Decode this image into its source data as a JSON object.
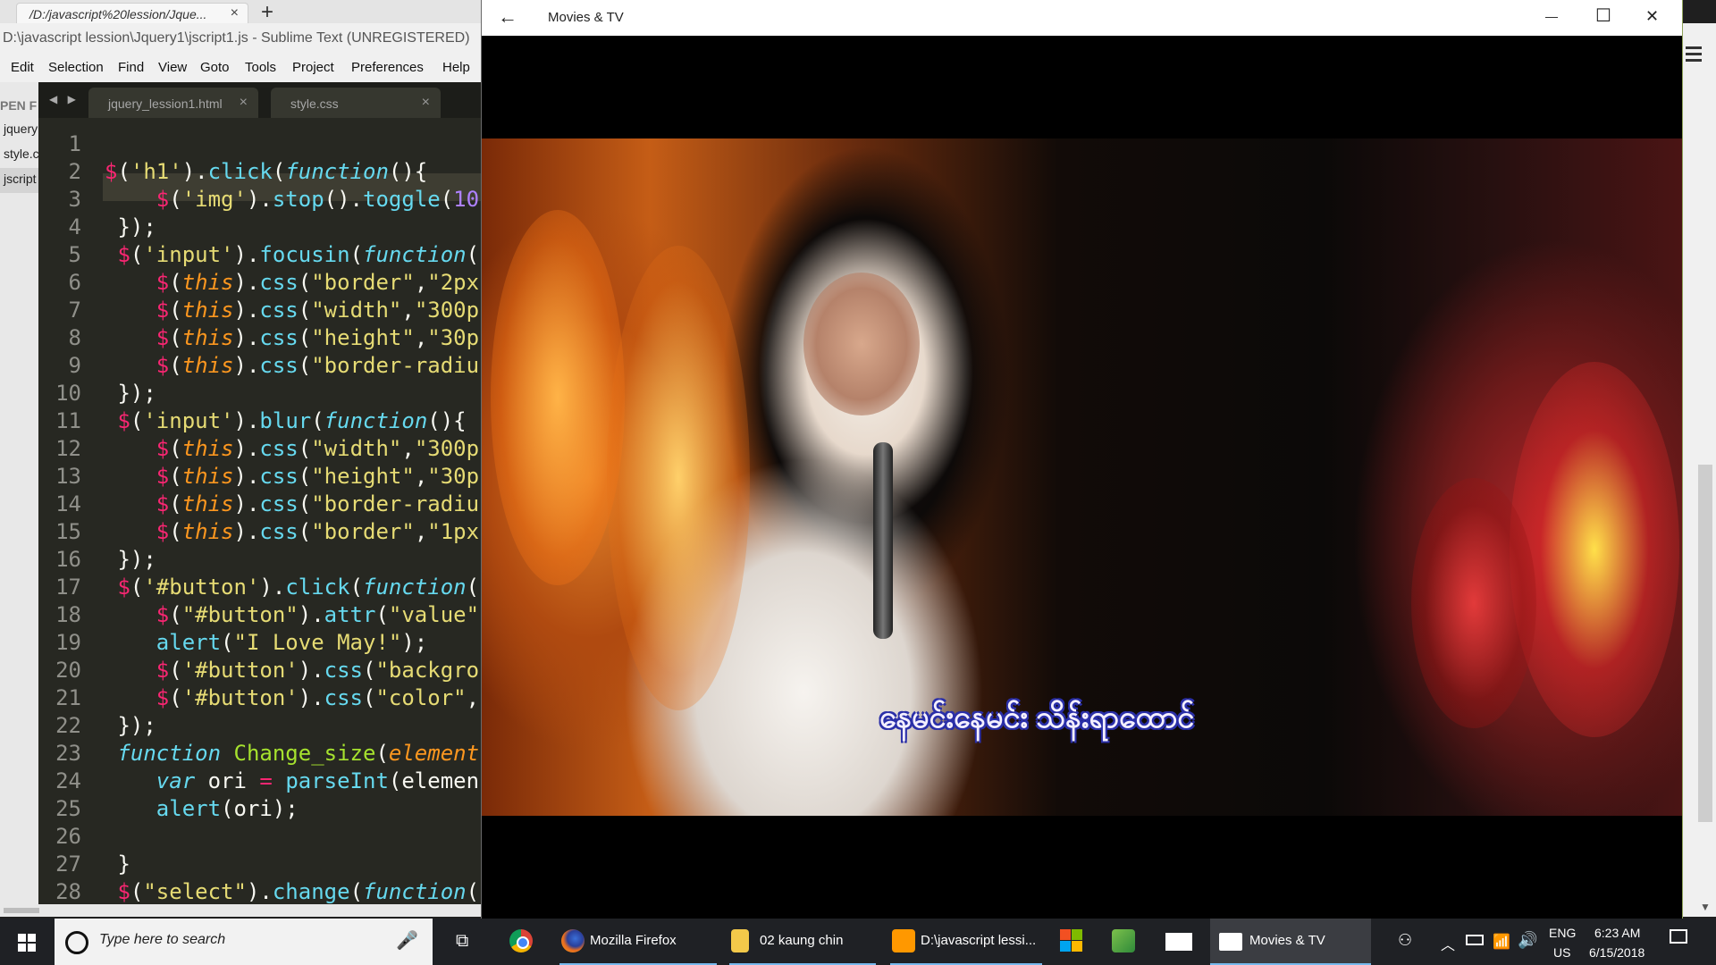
{
  "browser": {
    "tab_title": "/D:/javascript%20lession/Jque...",
    "tab_close": "×",
    "new_tab": "+"
  },
  "sublime": {
    "title": "D:\\javascript lession\\Jquery1\\jscript1.js - Sublime Text (UNREGISTERED)",
    "menu": [
      "Edit",
      "Selection",
      "Find",
      "View",
      "Goto",
      "Tools",
      "Project",
      "Preferences",
      "Help"
    ],
    "sidebar_header": "PEN F",
    "sidebar_files": [
      "jquery",
      "style.c",
      "jscript"
    ],
    "tab_arrows": "◀ ▶",
    "tabs": [
      {
        "label": "jquery_lession1.html",
        "close": "×"
      },
      {
        "label": "style.css",
        "close": "×"
      }
    ],
    "line_numbers": [
      "1",
      "2",
      "3",
      "4",
      "5",
      "6",
      "7",
      "8",
      "9",
      "10",
      "11",
      "12",
      "13",
      "14",
      "15",
      "16",
      "17",
      "18",
      "19",
      "20",
      "21",
      "22",
      "23",
      "24",
      "25",
      "26",
      "27",
      "28"
    ]
  },
  "movies_tv": {
    "app_name": "Movies & TV",
    "back": "←",
    "minimize": "—",
    "maximize": "☐",
    "close": "✕",
    "subtitle_text": "နေမင်းနေမင်း သိန်းရာထောင်"
  },
  "taskbar": {
    "search_placeholder": "Type here to search",
    "apps": [
      {
        "label": "Mozilla Firefox"
      },
      {
        "label": "02  kaung chin"
      },
      {
        "label": "D:\\javascript lessi..."
      },
      {
        "label": "Movies & TV"
      }
    ],
    "lang_top": "ENG",
    "lang_bottom": "US",
    "time": "6:23 AM",
    "date": "6/15/2018"
  },
  "colors": {
    "sublime_bg": "#272822",
    "keyword_pink": "#f92672",
    "string_yellow": "#e6db74",
    "function_blue": "#66d9ef",
    "param_orange": "#fd971f",
    "name_green": "#a6e22e",
    "taskbar_bg": "#1f2125",
    "active_accent": "#76b9ed"
  }
}
